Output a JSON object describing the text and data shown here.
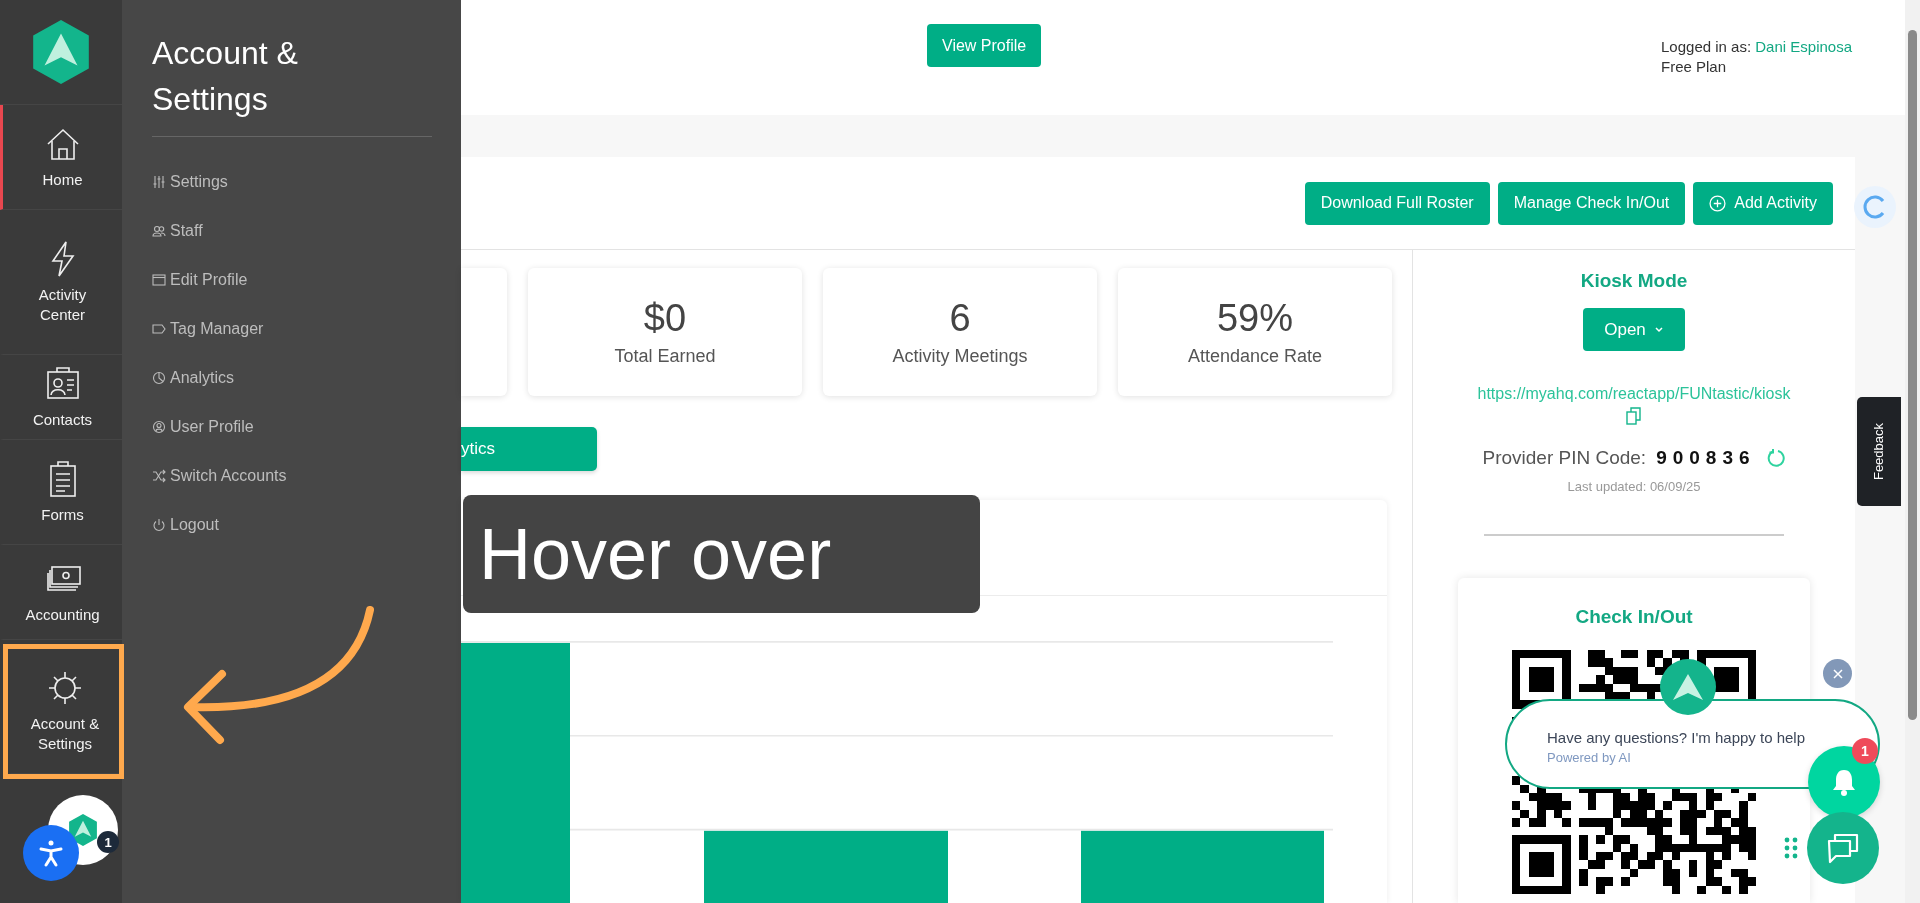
{
  "rail": {
    "items": [
      {
        "label": "Home",
        "selected": true,
        "highlighted": false
      },
      {
        "label": "Activity Center",
        "selected": false,
        "highlighted": false
      },
      {
        "label": "Contacts",
        "selected": false,
        "highlighted": false
      },
      {
        "label": "Forms",
        "selected": false,
        "highlighted": false
      },
      {
        "label": "Accounting",
        "selected": false,
        "highlighted": false
      },
      {
        "label": "Account & Settings",
        "selected": false,
        "highlighted": true
      }
    ],
    "avatar_badge": "1"
  },
  "flyout": {
    "title": "Account & Settings",
    "items": [
      "Settings",
      "Staff",
      "Edit Profile",
      "Tag Manager",
      "Analytics",
      "User Profile",
      "Switch Accounts",
      "Logout"
    ]
  },
  "header": {
    "view_profile": "View Profile",
    "logged_in_label": "Logged in as:",
    "user_name": "Dani Espinosa",
    "plan": "Free Plan"
  },
  "toolbar": {
    "buttons": [
      {
        "label": "Download Full Roster",
        "kind": "plain"
      },
      {
        "label": "Manage Check In/Out",
        "kind": "plain"
      },
      {
        "label": "Add Activity",
        "kind": "add"
      }
    ]
  },
  "stats": [
    {
      "value": "$0",
      "label": "Total Earned"
    },
    {
      "value": "6",
      "label": "Activity Meetings"
    },
    {
      "value": "59%",
      "label": "Attendance Rate"
    }
  ],
  "analytics_button": "ytics",
  "kiosk": {
    "title": "Kiosk Mode",
    "open_button": "Open",
    "url": "https://myahq.com/reactapp/FUNtastic/kiosk",
    "pin_label": "Provider PIN Code:",
    "pin": "900836",
    "last_updated": "Last updated: 06/09/25"
  },
  "check_in": {
    "title": "Check In/Out"
  },
  "chat": {
    "message": "Have any questions? I'm happy to help",
    "powered_by": "Powered by AI",
    "notification_count": "1"
  },
  "feedback": "Feedback",
  "annotation": {
    "text": "Hover over"
  }
}
